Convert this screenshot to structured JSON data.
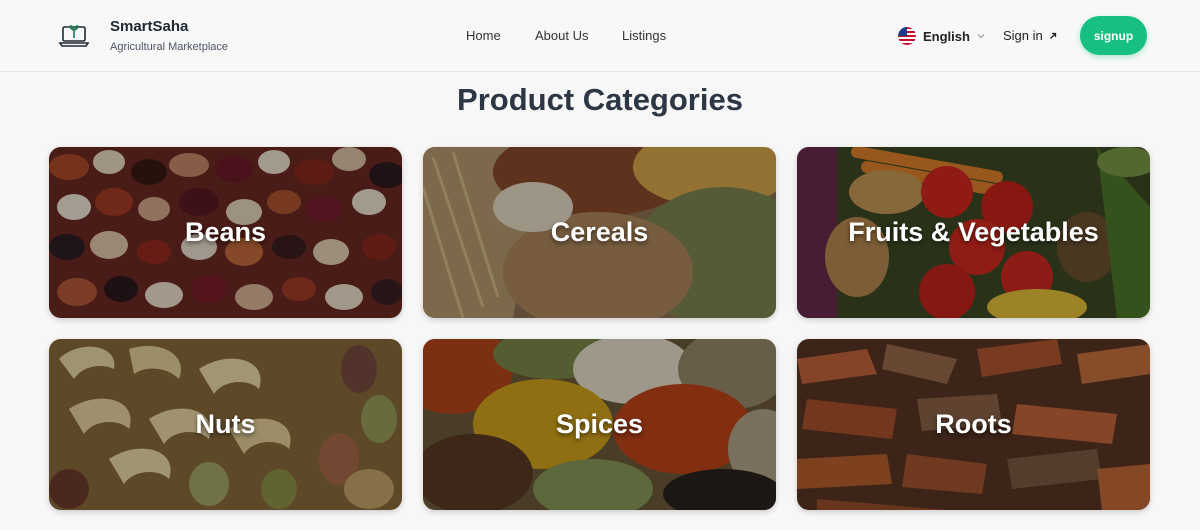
{
  "brand": {
    "name": "SmartSaha",
    "tagline": "Agricultural Marketplace"
  },
  "nav": {
    "home": "Home",
    "about": "About Us",
    "listings": "Listings"
  },
  "language": {
    "label": "English",
    "flag": "us-flag-icon"
  },
  "auth": {
    "signin": "Sign in",
    "signup": "signup"
  },
  "accent_color": "#17c081",
  "page_title": "Product Categories",
  "categories": [
    {
      "label": "Beans"
    },
    {
      "label": "Cereals"
    },
    {
      "label": "Fruits & Vegetables"
    },
    {
      "label": "Nuts"
    },
    {
      "label": "Spices"
    },
    {
      "label": "Roots"
    }
  ]
}
